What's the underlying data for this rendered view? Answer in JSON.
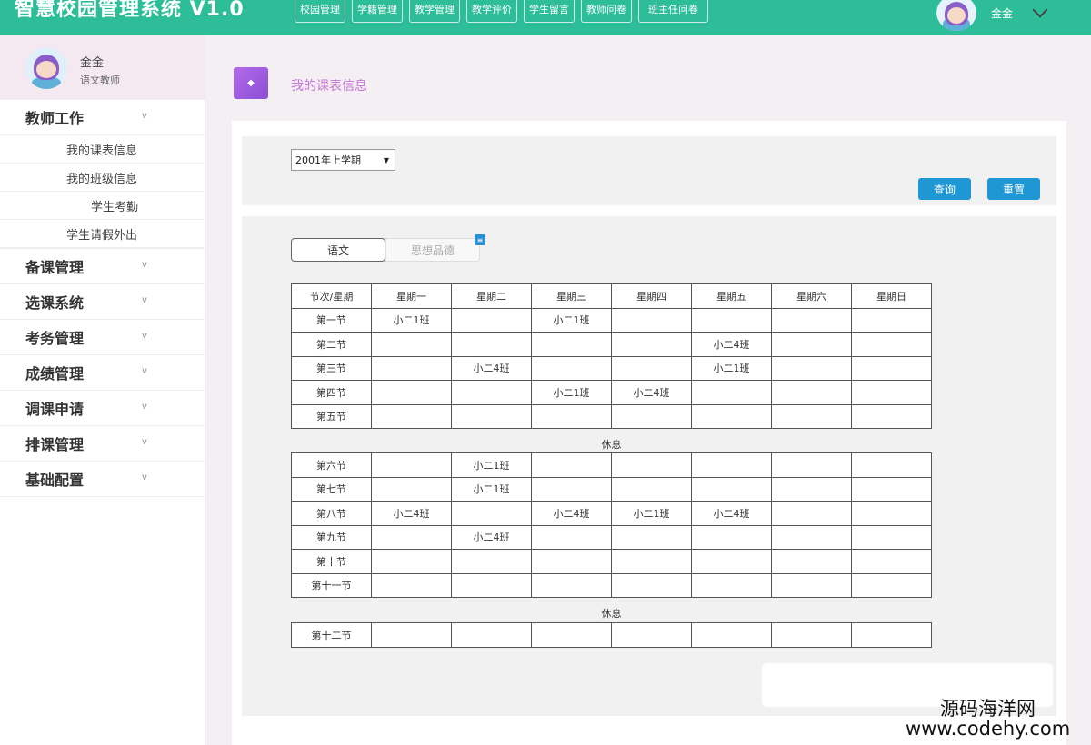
{
  "app": {
    "title": "智慧校园管理系统 V1.0"
  },
  "topnav": [
    "校园管理",
    "学籍管理",
    "教学管理",
    "教学评价",
    "学生留言",
    "教师问卷",
    "班主任问卷"
  ],
  "user": {
    "name": "金金",
    "role": "语文教师"
  },
  "sidebar": {
    "groups": [
      {
        "label": "教师工作",
        "toggle": "v",
        "items": [
          "我的课表信息",
          "我的班级信息",
          "学生考勤",
          "学生请假外出"
        ]
      },
      {
        "label": "备课管理",
        "toggle": "v",
        "items": []
      },
      {
        "label": "选课系统",
        "toggle": "v",
        "items": []
      },
      {
        "label": "考务管理",
        "toggle": "v",
        "items": []
      },
      {
        "label": "成绩管理",
        "toggle": "v",
        "items": []
      },
      {
        "label": "调课申请",
        "toggle": "v",
        "items": []
      },
      {
        "label": "排课管理",
        "toggle": "v",
        "items": []
      },
      {
        "label": "基础配置",
        "toggle": "v",
        "items": []
      }
    ]
  },
  "page": {
    "title": "我的课表信息",
    "icon": "diamond-icon"
  },
  "filter": {
    "semester": "2001年上学期",
    "query_label": "查询",
    "reset_label": "重置"
  },
  "tabs": {
    "active": "语文",
    "inactive": "思想品德",
    "badge": "≡"
  },
  "schedule": {
    "headers": [
      "节次/星期",
      "星期一",
      "星期二",
      "星期三",
      "星期四",
      "星期五",
      "星期六",
      "星期日"
    ],
    "block1": [
      [
        "第一节",
        "小二1班",
        "",
        "小二1班",
        "",
        "",
        "",
        ""
      ],
      [
        "第二节",
        "",
        "",
        "",
        "",
        "小二4班",
        "",
        ""
      ],
      [
        "第三节",
        "",
        "小二4班",
        "",
        "",
        "小二1班",
        "",
        ""
      ],
      [
        "第四节",
        "",
        "",
        "小二1班",
        "小二4班",
        "",
        "",
        ""
      ],
      [
        "第五节",
        "",
        "",
        "",
        "",
        "",
        "",
        ""
      ]
    ],
    "break1": "休息",
    "block2": [
      [
        "第六节",
        "",
        "小二1班",
        "",
        "",
        "",
        "",
        ""
      ],
      [
        "第七节",
        "",
        "小二1班",
        "",
        "",
        "",
        "",
        ""
      ],
      [
        "第八节",
        "小二4班",
        "",
        "小二4班",
        "小二1班",
        "小二4班",
        "",
        ""
      ],
      [
        "第九节",
        "",
        "小二4班",
        "",
        "",
        "",
        "",
        ""
      ],
      [
        "第十节",
        "",
        "",
        "",
        "",
        "",
        "",
        ""
      ],
      [
        "第十一节",
        "",
        "",
        "",
        "",
        "",
        "",
        ""
      ]
    ],
    "break2": "休息",
    "block3": [
      [
        "第十二节",
        "",
        "",
        "",
        "",
        "",
        "",
        ""
      ]
    ]
  },
  "watermark": {
    "cn": "源码海洋网",
    "url": "www.codehy.com"
  }
}
